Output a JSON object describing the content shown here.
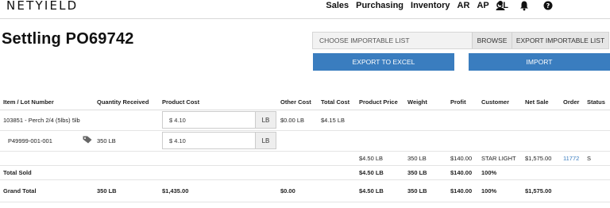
{
  "logo": "NETYIELD",
  "nav": {
    "items": [
      "Sales",
      "Purchasing",
      "Inventory",
      "AR",
      "AP",
      "GL"
    ],
    "icons": [
      "user-icon",
      "bell-icon",
      "help-icon"
    ]
  },
  "page_title": "Settling PO69742",
  "import": {
    "placeholder": "CHOOSE IMPORTABLE LIST",
    "browse_label": "BROWSE",
    "export_list_label": "EXPORT IMPORTABLE LIST",
    "export_excel_label": "EXPORT TO EXCEL",
    "import_label": "IMPORT"
  },
  "table": {
    "headers": [
      "Item / Lot Number",
      "Quantity Received",
      "Product Cost",
      "Other Cost",
      "Total Cost",
      "Product Price",
      "Weight",
      "Profit",
      "Customer",
      "Net Sale",
      "Order",
      "Status"
    ],
    "item_row": {
      "item": "103851 - Perch 2/4 (5lbs) 5lb",
      "product_cost": "$ 4.10",
      "unit": "LB",
      "other_cost": "$0.00 LB",
      "total_cost": "$4.15 LB"
    },
    "lot_row": {
      "lot": "P49999-001-001",
      "quantity": "350 LB",
      "product_cost": "$ 4.10",
      "unit": "LB"
    },
    "sale_row": {
      "product_price": "$4.50 LB",
      "weight": "350 LB",
      "profit": "$140.00",
      "customer": "STAR LIGHT",
      "net_sale": "$1,575.00",
      "order": "11772",
      "status": "S"
    },
    "total_sold_row": {
      "label": "Total Sold",
      "product_price": "$4.50 LB",
      "weight": "350 LB",
      "profit": "$140.00",
      "customer": "100%"
    },
    "grand_total_row": {
      "label": "Grand Total",
      "quantity": "350 LB",
      "product_cost": "$1,435.00",
      "other_cost": "$0.00",
      "product_price": "$4.50 LB",
      "weight": "350 LB",
      "profit": "$140.00",
      "customer": "100%",
      "net_sale": "$1,575.00"
    }
  },
  "colors": {
    "accent": "#3a7dbf",
    "button_grey": "#e6e6e6"
  }
}
